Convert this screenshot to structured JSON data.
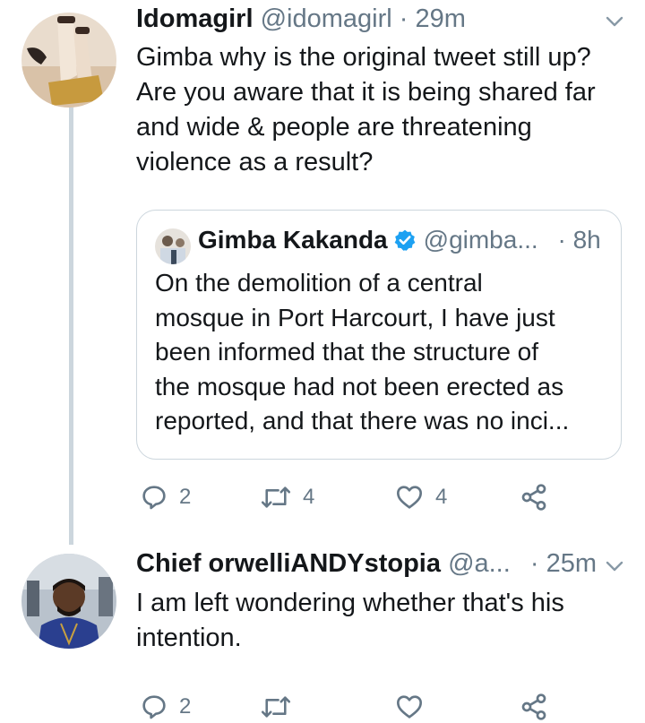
{
  "tweet1": {
    "display_name": "Idomagirl",
    "handle": "@idomagirl",
    "separator": " · ",
    "time": "29m",
    "text_lines": [
      "Gimba why is the original tweet still up?",
      "Are you aware that it is being shared far",
      "and wide & people are threatening",
      "violence as a result?"
    ],
    "quoted": {
      "display_name": "Gimba Kakanda",
      "handle": "@gimba...",
      "separator": " · ",
      "time": "8h",
      "text_lines": [
        "On the demolition of a central",
        "mosque in Port Harcourt, I have just",
        "been informed that the structure of",
        "the mosque had not been erected as",
        "reported, and that there was no inci..."
      ]
    },
    "actions": {
      "replies": "2",
      "retweets": "4",
      "likes": "4"
    }
  },
  "tweet2": {
    "display_name": "Chief orwelliANDYstopia",
    "handle": "@a...",
    "separator": " · ",
    "time": "25m",
    "text_lines": [
      "I am left wondering whether that's his",
      "intention."
    ],
    "actions": {
      "replies": "2",
      "retweets": "",
      "likes": ""
    }
  },
  "icons": {
    "reply": "reply-icon",
    "retweet": "retweet-icon",
    "like": "heart-icon",
    "share": "share-icon",
    "more": "chevron-down-icon",
    "verified": "verified-badge-icon"
  },
  "colors": {
    "text": "#14171a",
    "muted": "#657786",
    "verified": "#1da1f2",
    "thread_line": "#ccd6dd"
  }
}
